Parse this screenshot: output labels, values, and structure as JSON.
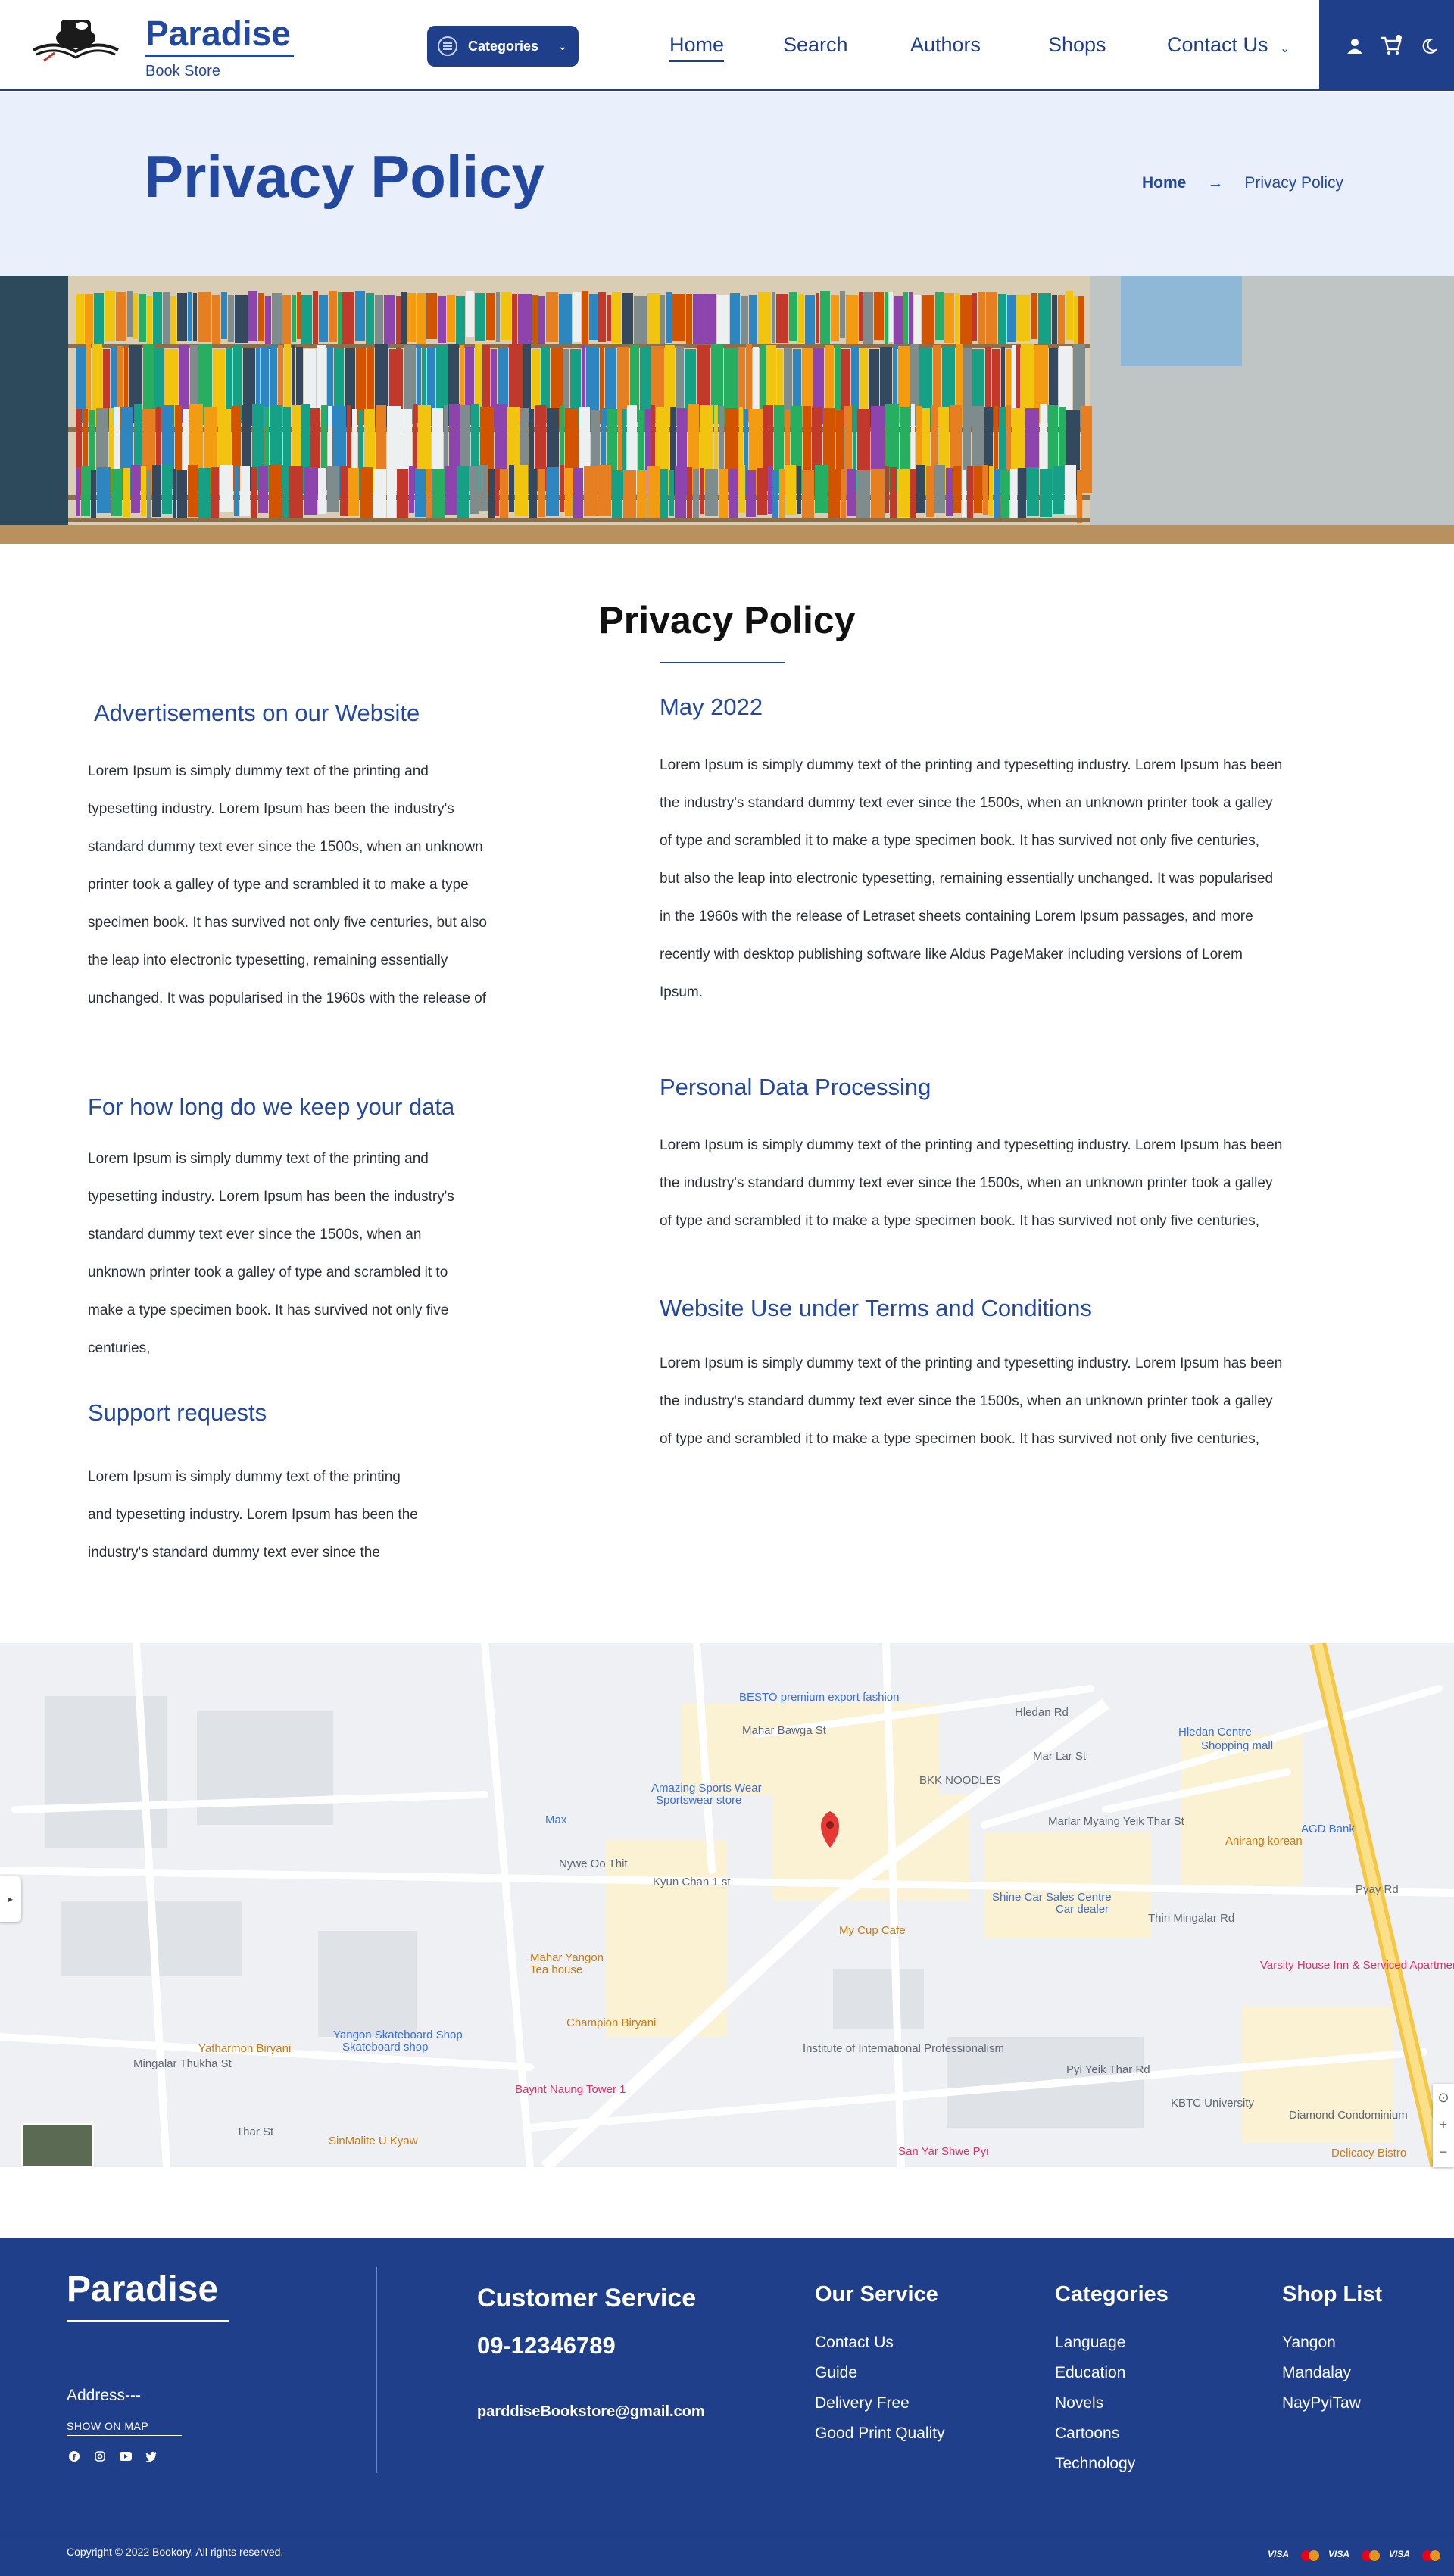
{
  "header": {
    "brand_name": "Paradise",
    "brand_sub": "Book Store",
    "categories_label": "Categories",
    "nav": [
      {
        "label": "Home",
        "active": true
      },
      {
        "label": "Search",
        "active": false
      },
      {
        "label": "Authors",
        "active": false
      },
      {
        "label": "Shops",
        "active": false
      },
      {
        "label": "Contact Us",
        "active": false
      }
    ],
    "icons": [
      "user-icon",
      "cart-icon",
      "moon-icon"
    ]
  },
  "hero": {
    "title": "Privacy Policy",
    "breadcrumb_home": "Home",
    "breadcrumb_current": "Privacy Policy"
  },
  "content": {
    "title": "Privacy Policy",
    "left": [
      {
        "heading": "Advertisements on our Website",
        "lines": [
          "Lorem Ipsum is simply dummy text of the printing and",
          "typesetting industry. Lorem Ipsum has been the industry's",
          "standard dummy text ever since the 1500s, when an unknown",
          "printer took a galley of type and scrambled it to make a type",
          "specimen book. It has survived not only five centuries, but also",
          "the leap into electronic typesetting, remaining essentially",
          "unchanged. It was popularised in the 1960s with the release of"
        ]
      },
      {
        "heading": "For how long do we keep your data",
        "lines": [
          "Lorem Ipsum is simply dummy text of the printing and",
          "typesetting industry. Lorem Ipsum has been the industry's",
          "standard dummy text ever since the 1500s, when an",
          "unknown printer took a galley of type and scrambled it to",
          "make a type specimen book. It has survived not only five",
          "centuries,"
        ]
      },
      {
        "heading": "Support requests",
        "lines": [
          "Lorem Ipsum is simply dummy text of the printing",
          "and typesetting industry. Lorem Ipsum has been the",
          "industry's standard dummy text ever since the"
        ]
      }
    ],
    "right": [
      {
        "heading": "May 2022",
        "lines": [
          "Lorem Ipsum is simply dummy text of the printing and typesetting industry. Lorem Ipsum has been",
          "the industry's standard dummy text ever since the 1500s, when an unknown printer took a galley",
          "of type and scrambled it to make a type specimen book. It has survived not only five centuries,",
          "but also the leap into electronic typesetting, remaining essentially unchanged. It was popularised",
          "in the 1960s with the release of Letraset sheets containing Lorem Ipsum passages, and more",
          "recently with desktop publishing software like Aldus PageMaker including versions of Lorem",
          "Ipsum."
        ]
      },
      {
        "heading": "Personal Data Processing",
        "lines": [
          "Lorem Ipsum is simply dummy text of the printing and typesetting industry. Lorem Ipsum has been",
          "the industry's standard dummy text ever since the 1500s, when an unknown printer took a galley",
          "of type and scrambled it to make a type specimen book. It has survived not only five centuries,"
        ]
      },
      {
        "heading": "Website Use under Terms and Conditions",
        "lines": [
          "Lorem Ipsum is simply dummy text of the printing and typesetting industry. Lorem Ipsum has been",
          "the industry's standard dummy text ever since the 1500s, when an unknown printer took a galley",
          "of type and scrambled it to make a type specimen book. It has survived not only five centuries,"
        ]
      }
    ]
  },
  "map": {
    "labels": [
      "BESTO premium export fashion",
      "Mahar Bawga St",
      "Hledan Rd",
      "Hledan Centre",
      "Shopping mall",
      "BKK NOODLES",
      "Mar Lar St",
      "Amazing Sports Wear",
      "Sportswear store",
      "Max",
      "Marlar Myaing Yeik Thar St",
      "AGD Bank",
      "Anirang korean",
      "Nywe Oo Thit",
      "Kyun Chan 1 st",
      "Shine Car Sales Centre",
      "Car dealer",
      "Thiri Mingalar Rd",
      "Pyay Rd",
      "Mahar Yangon",
      "Tea house",
      "My Cup Cafe",
      "Varsity House Inn & Serviced Apartment",
      "Champion Biryani",
      "Yangon Skateboard Shop",
      "Skateboard shop",
      "Institute of International Professionalism",
      "Pyi Yeik Thar Rd",
      "Yatharmon Biryani",
      "Bayint Naung Tower 1",
      "KBTC University",
      "Diamond Condominium",
      "SinMalite U Kyaw",
      "San Yar Shwe Pyi",
      "Delicacy Bistro",
      "Mingalar Thukha St",
      "Thar St"
    ]
  },
  "footer": {
    "brand": "Paradise",
    "address": "Address---",
    "show_on_map": "SHOW ON MAP",
    "cs_heading": "Customer Service",
    "phone": "09-12346789",
    "email": "parddiseBookstore@gmail.com",
    "our_service": {
      "heading": "Our Service",
      "items": [
        "Contact Us",
        "Guide",
        "Delivery Free",
        "Good Print Quality"
      ]
    },
    "categories": {
      "heading": "Categories",
      "items": [
        "Language",
        "Education",
        "Novels",
        "Cartoons",
        "Technology"
      ]
    },
    "shop_list": {
      "heading": "Shop List",
      "items": [
        "Yangon",
        "Mandalay",
        "NayPyiTaw"
      ]
    },
    "copyright": "Copyright © 2022 Bookory. All rights reserved.",
    "payment_labels": [
      "VISA",
      "VISA",
      "VISA"
    ],
    "social_icons": [
      "facebook-icon",
      "instagram-icon",
      "youtube-icon",
      "twitter-icon"
    ]
  },
  "colors": {
    "primary": "#1f3f8a",
    "accent": "#2348a0",
    "hero_bg": "#e9f0fb",
    "map_pin": "#e53935"
  }
}
